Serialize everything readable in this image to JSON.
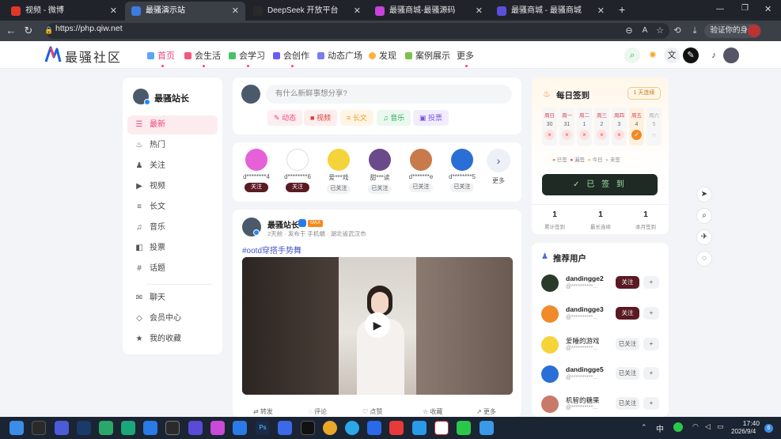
{
  "browser": {
    "tabs": [
      {
        "label": "视频 - 微博",
        "color": "#e2372b"
      },
      {
        "label": "最骚演示站",
        "color": "#3c7ce0"
      },
      {
        "label": "DeepSeek 开放平台",
        "color": "#2a2a2a"
      },
      {
        "label": "最骚商城-最骚源码",
        "color": "#c843d9"
      },
      {
        "label": "最骚商城 - 最骚商城",
        "color": "#5a4fd8"
      }
    ],
    "url": "https://php.qiw.net",
    "verify_label": "验证你的身份"
  },
  "site": {
    "logo": "最骚社区",
    "nav": [
      {
        "label": "首页",
        "color": "#5ba5f5",
        "active": true
      },
      {
        "label": "会生活",
        "color": "#f25a7c"
      },
      {
        "label": "会学习",
        "color": "#47c26a"
      },
      {
        "label": "会创作",
        "color": "#6a5cf5"
      },
      {
        "label": "动态广场",
        "color": "#7d7bf0"
      },
      {
        "label": "发现",
        "color": "#ffb23a"
      },
      {
        "label": "案例展示",
        "color": "#7cc24a"
      },
      {
        "label": "更多",
        "color": "#999"
      }
    ],
    "accent": "#f0447b"
  },
  "left": {
    "user": "最骚站长",
    "menu": [
      {
        "icon": "list-icon",
        "glyph": "☰",
        "label": "最新"
      },
      {
        "icon": "flame-icon",
        "glyph": "♨",
        "label": "热门"
      },
      {
        "icon": "users-icon",
        "glyph": "♟",
        "label": "关注"
      },
      {
        "icon": "video-icon",
        "glyph": "▶",
        "label": "视频"
      },
      {
        "icon": "document-icon",
        "glyph": "≡",
        "label": "长文"
      },
      {
        "icon": "music-icon",
        "glyph": "♫",
        "label": "音乐"
      },
      {
        "icon": "vote-icon",
        "glyph": "◧",
        "label": "投票"
      },
      {
        "icon": "hash-icon",
        "glyph": "#",
        "label": "话题"
      }
    ],
    "menu2": [
      {
        "icon": "chat-icon",
        "glyph": "✉",
        "label": "聊天"
      },
      {
        "icon": "diamond-icon",
        "glyph": "◇",
        "label": "会员中心"
      },
      {
        "icon": "star-icon",
        "glyph": "★",
        "label": "我的收藏"
      }
    ]
  },
  "postbox": {
    "placeholder": "有什么新鲜事想分享?",
    "buttons": [
      {
        "label": "动态",
        "color": "#f0447b",
        "bg": "#fdeef2",
        "glyph": "✎"
      },
      {
        "label": "视频",
        "color": "#e23b3b",
        "bg": "#fdeeee",
        "glyph": "■"
      },
      {
        "label": "长文",
        "color": "#f0a020",
        "bg": "#fff5e6",
        "glyph": "≡"
      },
      {
        "label": "音乐",
        "color": "#2fb05a",
        "bg": "#ebf8ef",
        "glyph": "♫"
      },
      {
        "label": "投票",
        "color": "#7a56e6",
        "bg": "#f1edfd",
        "glyph": "▣"
      }
    ]
  },
  "users": [
    {
      "name": "d********4",
      "btn": "关注",
      "style": "dark",
      "color": "#e660d8"
    },
    {
      "name": "d********6",
      "btn": "关注",
      "style": "dark",
      "color": "#ffffff"
    },
    {
      "name": "爱***戏",
      "btn": "已关注",
      "style": "light",
      "color": "#f5d33b"
    },
    {
      "name": "甜***读",
      "btn": "已关注",
      "style": "light",
      "color": "#6b4a8c"
    },
    {
      "name": "d*******e",
      "btn": "已关注",
      "style": "light",
      "color": "#c87a4a"
    },
    {
      "name": "d********5",
      "btn": "已关注",
      "style": "light",
      "color": "#2a6fd6"
    }
  ],
  "more_label": "更多",
  "post": {
    "author": "最骚站长",
    "badge": "MAX",
    "meta": "2天前 · 发布于 手机端 · 湖北省武汉市",
    "topic": "#ootd穿搭手势舞",
    "actions": [
      "转发",
      "评论",
      "点赞",
      "收藏",
      "更多"
    ]
  },
  "signin": {
    "title": "每日签到",
    "streak_label": "1 天连续",
    "days": [
      {
        "wd": "周日",
        "dn": "30",
        "mark": "×"
      },
      {
        "wd": "周一",
        "dn": "31",
        "mark": "×"
      },
      {
        "wd": "周二",
        "dn": "1",
        "mark": "×"
      },
      {
        "wd": "周三",
        "dn": "2",
        "mark": "×"
      },
      {
        "wd": "周四",
        "dn": "3",
        "mark": "×"
      },
      {
        "wd": "周五",
        "dn": "4",
        "mark": "✓"
      },
      {
        "wd": "周六",
        "dn": "5",
        "mark": "○"
      }
    ],
    "legend": [
      "已签",
      "漏签",
      "今日",
      "未签"
    ],
    "button": "✓ 已 签 到",
    "stats": [
      {
        "v": "1",
        "l": "累计签到"
      },
      {
        "v": "1",
        "l": "最长连续"
      },
      {
        "v": "1",
        "l": "本月签到"
      }
    ]
  },
  "recommend": {
    "title": "推荐用户",
    "users": [
      {
        "name": "dandingge2",
        "sub": "@**********...",
        "btn": "关注",
        "dark": true,
        "color": "#2a3a2a"
      },
      {
        "name": "dandingge3",
        "sub": "@**********...",
        "btn": "关注",
        "dark": true,
        "color": "#f08a2a"
      },
      {
        "name": "爱睡的游戏",
        "sub": "@**********...",
        "btn": "已关注",
        "dark": false,
        "color": "#f5d33b"
      },
      {
        "name": "dandingge5",
        "sub": "@**********...",
        "btn": "已关注",
        "dark": false,
        "color": "#2a6fd6"
      },
      {
        "name": "机智的糖果",
        "sub": "@**********...",
        "btn": "已关注",
        "dark": false,
        "color": "#c87a6a"
      }
    ]
  },
  "taskbar": {
    "time": "17:40",
    "date": "2026/9/4",
    "ime": "中"
  }
}
